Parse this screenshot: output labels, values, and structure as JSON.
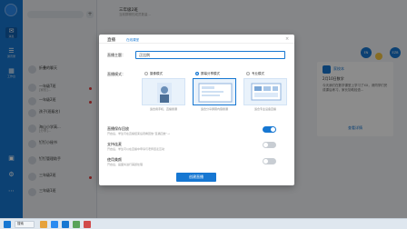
{
  "app": {
    "title": "三年级2班",
    "subtitle": "当前群聊的成员数量..."
  },
  "rail": {
    "items": [
      {
        "icon": "chat-icon",
        "label": "消息"
      },
      {
        "icon": "contacts-icon",
        "label": "通讯录"
      },
      {
        "icon": "apps-icon",
        "label": "工作台"
      }
    ]
  },
  "chatlist": {
    "items": [
      {
        "name": "折叠的聊天",
        "preview": "",
        "time": ""
      },
      {
        "name": "一年级7班",
        "preview": "[家校]...",
        "time": ""
      },
      {
        "name": "一年级2班",
        "preview": "...",
        "time": ""
      },
      {
        "name": "孩子(班级名)",
        "preview": "",
        "time": ""
      },
      {
        "name": "海山小学高...",
        "preview": "[分享]...",
        "time": ""
      },
      {
        "name": "钉钉小秘书",
        "preview": "...",
        "time": ""
      },
      {
        "name": "钉钉管理助手",
        "preview": "...",
        "time": ""
      },
      {
        "name": "三年级2班",
        "preview": "...",
        "time": ""
      },
      {
        "name": "三年级1班",
        "preview": "...",
        "time": ""
      }
    ]
  },
  "chat": {
    "right_avatar": "EN",
    "right_avatar2": "EZB",
    "notice": {
      "header": "家校本",
      "title": "2月10日数学",
      "body": "今天我们在数学课堂上学习了XX，请同学们完成课后练习，家长协助检查...",
      "link": "查看详情"
    }
  },
  "modal": {
    "title": "直播",
    "tag": "在线课堂",
    "close": "×",
    "topic_label": "直播主题：",
    "topic_value": "正比例",
    "mode_label": "直播模式：",
    "modes": [
      {
        "label": "摄像模式",
        "caption": "适合用手机、直播授课",
        "selected": false
      },
      {
        "label": "屏幕分享模式",
        "caption": "适合分享屏幕内容授课",
        "selected": true
      },
      {
        "label": "专业模式",
        "caption": "适合专业设备直播",
        "selected": false
      }
    ],
    "options": [
      {
        "title": "直播保存回放",
        "desc": "开启后，学生可在直播结束后观看回放“直播回放”→",
        "on": true
      },
      {
        "title": "支持连麦",
        "desc": "开启后，学生可以在直播中申请与老师连麦互动",
        "on": false
      },
      {
        "title": "使用美颜",
        "desc": "开启后，画面将进行美颜处理",
        "on": false
      }
    ],
    "create_label": "创建直播"
  },
  "taskbar": {
    "search_placeholder": "搜索"
  }
}
